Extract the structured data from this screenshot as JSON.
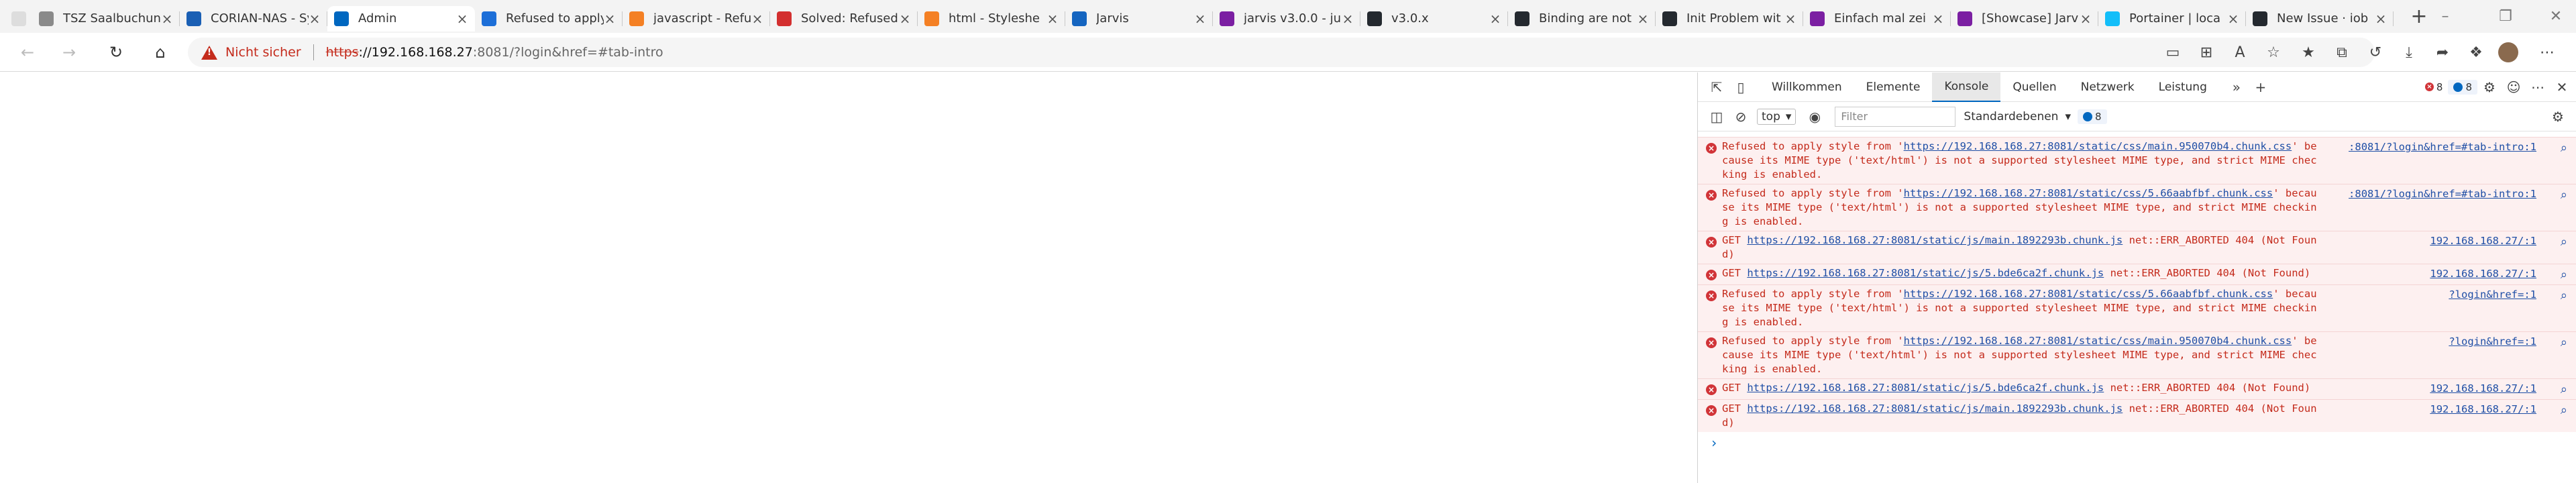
{
  "tabs": [
    {
      "title": "TSZ Saalbuchung",
      "color": "#8a8a8a",
      "active": false
    },
    {
      "title": "CORIAN-NAS - Sy",
      "color": "#1a5fb4",
      "active": false
    },
    {
      "title": "Admin",
      "color": "#0067c0",
      "active": true
    },
    {
      "title": "Refused to apply",
      "color": "#1d6fd8",
      "active": false
    },
    {
      "title": "javascript - Refu",
      "color": "#f48024",
      "active": false
    },
    {
      "title": "Solved: Refused",
      "color": "#d32f2f",
      "active": false
    },
    {
      "title": "html - Styleshe",
      "color": "#f48024",
      "active": false
    },
    {
      "title": "Jarvis",
      "color": "#1565c0",
      "active": false
    },
    {
      "title": "jarvis v3.0.0 - ju",
      "color": "#7b1fa2",
      "active": false
    },
    {
      "title": "v3.0.x",
      "color": "#24292f",
      "active": false
    },
    {
      "title": "Binding are not",
      "color": "#24292f",
      "active": false
    },
    {
      "title": "Init Problem wit",
      "color": "#24292f",
      "active": false
    },
    {
      "title": "Einfach mal zei",
      "color": "#7b1fa2",
      "active": false
    },
    {
      "title": "[Showcase] Jarv",
      "color": "#7b1fa2",
      "active": false
    },
    {
      "title": "Portainer | loca",
      "color": "#13bef9",
      "active": false
    },
    {
      "title": "New Issue · iob",
      "color": "#24292f",
      "active": false
    }
  ],
  "new_tab_label": "+",
  "address": {
    "security_label": "Nicht sicher",
    "scheme": "https",
    "host": "://192.168.168.27",
    "rest": ":8081/?login&href=#tab-intro"
  },
  "devtools": {
    "tabs": [
      "Willkommen",
      "Elemente",
      "Konsole",
      "Quellen",
      "Netzwerk",
      "Leistung"
    ],
    "active_tab": "Konsole",
    "error_count": "8",
    "info_count": "8",
    "context": "top",
    "filter_placeholder": "Filter",
    "levels_label": "Standardebenen",
    "levels_count": "8"
  },
  "console": {
    "messages": [
      {
        "type": "error",
        "prefix": "Refused to apply style from '",
        "link": "https://192.168.168.27:8081/static/css/main.950070b4.chunk.css",
        "suffix": "' because its MIME type ('text/html') is not a supported stylesheet MIME type, and strict MIME checking is enabled.",
        "source": ":8081/?login&href=#tab-intro:1"
      },
      {
        "type": "error",
        "prefix": "Refused to apply style from '",
        "link": "https://192.168.168.27:8081/static/css/5.66aabfbf.chunk.css",
        "suffix": "' because its MIME type ('text/html') is not a supported stylesheet MIME type, and strict MIME checking is enabled.",
        "source": ":8081/?login&href=#tab-intro:1"
      },
      {
        "type": "error",
        "prefix": "GET ",
        "link": "https://192.168.168.27:8081/static/js/main.1892293b.chunk.js",
        "suffix": " net::ERR_ABORTED 404 (Not Found)",
        "source": "192.168.168.27/:1"
      },
      {
        "type": "error",
        "prefix": "GET ",
        "link": "https://192.168.168.27:8081/static/js/5.bde6ca2f.chunk.js",
        "suffix": " net::ERR_ABORTED 404 (Not Found)",
        "source": "192.168.168.27/:1"
      },
      {
        "type": "error",
        "prefix": "Refused to apply style from '",
        "link": "https://192.168.168.27:8081/static/css/5.66aabfbf.chunk.css",
        "suffix": "' because its MIME type ('text/html') is not a supported stylesheet MIME type, and strict MIME checking is enabled.",
        "source": "?login&href=:1"
      },
      {
        "type": "error",
        "prefix": "Refused to apply style from '",
        "link": "https://192.168.168.27:8081/static/css/main.950070b4.chunk.css",
        "suffix": "' because its MIME type ('text/html') is not a supported stylesheet MIME type, and strict MIME checking is enabled.",
        "source": "?login&href=:1"
      },
      {
        "type": "error",
        "prefix": "GET ",
        "link": "https://192.168.168.27:8081/static/js/5.bde6ca2f.chunk.js",
        "suffix": " net::ERR_ABORTED 404 (Not Found)",
        "source": "192.168.168.27/:1"
      },
      {
        "type": "error",
        "prefix": "GET ",
        "link": "https://192.168.168.27:8081/static/js/main.1892293b.chunk.js",
        "suffix": " net::ERR_ABORTED 404 (Not Found)",
        "source": "192.168.168.27/:1"
      }
    ],
    "prompt_symbol": "›"
  }
}
